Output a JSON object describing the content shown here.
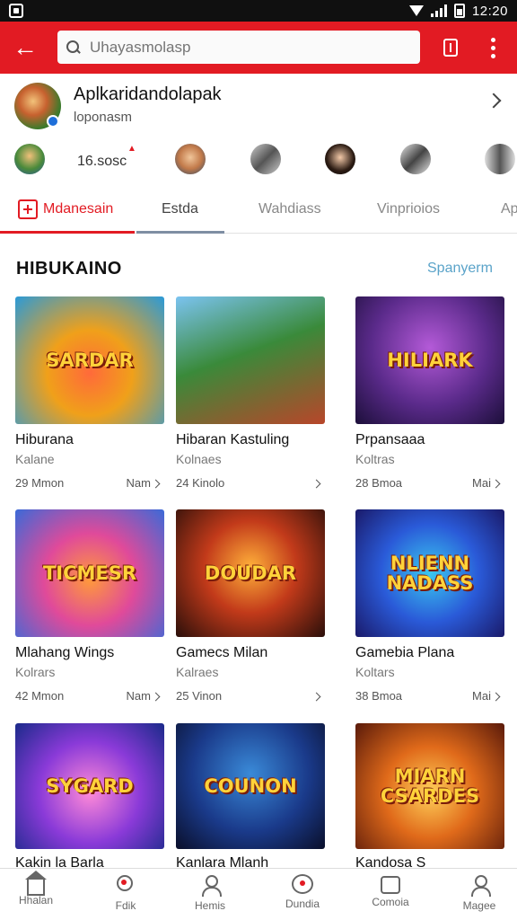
{
  "status_bar": {
    "time": "12:20"
  },
  "toolbar": {
    "search_placeholder": "Uhayasmolasp",
    "colors": {
      "primary": "#e21b23"
    }
  },
  "profile": {
    "name": "Aplkaridandolapak",
    "subtitle": "loponasm"
  },
  "people_row": {
    "count_text": "16.sosc"
  },
  "tabs": [
    {
      "label": "Mdanesain",
      "active": true
    },
    {
      "label": "Estda"
    },
    {
      "label": "Wahdiass"
    },
    {
      "label": "Vinprioios"
    },
    {
      "label": "Ap"
    }
  ],
  "section": {
    "title": "HIBUKAINO",
    "link": "Spanyerm"
  },
  "cards": [
    {
      "thumb_text": "SARDAR",
      "title": "Hiburana",
      "subtitle": "Kalane",
      "meta": "29 Mmon",
      "more": "Nam"
    },
    {
      "thumb_text": "",
      "title": "Hibaran Kastuling",
      "subtitle": "Kolnaes",
      "meta": "24 Kinolo",
      "more": ""
    },
    {
      "thumb_text": "HILIARK",
      "title": "Prpansaaa",
      "subtitle": "Koltras",
      "meta": "28 Bmoa",
      "more": "Mai"
    },
    {
      "thumb_text": "TICMESR",
      "title": "Mlahang Wings",
      "subtitle": "Kolrars",
      "meta": "42 Mmon",
      "more": "Nam"
    },
    {
      "thumb_text": "DOUDAR",
      "title": "Gamecs Milan",
      "subtitle": "Kalraes",
      "meta": "25 Vinon",
      "more": ""
    },
    {
      "thumb_text": "NLIENN NADASS",
      "title": "Gamebia Plana",
      "subtitle": "Koltars",
      "meta": "38 Bmoa",
      "more": "Mai"
    },
    {
      "thumb_text": "SYGARD",
      "title": "Kakin la Barla",
      "subtitle": "",
      "meta": "",
      "more": ""
    },
    {
      "thumb_text": "COUNON",
      "title": "Kanlara Mlanh",
      "subtitle": "",
      "meta": "",
      "more": ""
    },
    {
      "thumb_text": "MIARN CSARDES",
      "title": "Kandosa S",
      "subtitle": "",
      "meta": "",
      "more": ""
    }
  ],
  "bottom_nav": [
    {
      "label": "Hhalan",
      "icon": "home-icon"
    },
    {
      "label": "Fdik",
      "icon": "discover-icon"
    },
    {
      "label": "Hemis",
      "icon": "person-icon"
    },
    {
      "label": "Dundia",
      "icon": "chat-icon"
    },
    {
      "label": "Comoia",
      "icon": "store-icon"
    },
    {
      "label": "Magee",
      "icon": "profile-icon"
    }
  ]
}
